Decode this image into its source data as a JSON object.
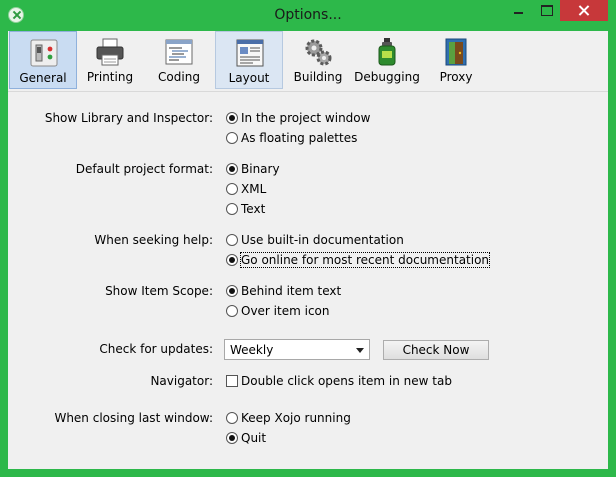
{
  "window": {
    "title": "Options..."
  },
  "toolbar": {
    "items": [
      {
        "label": "General",
        "icon": "general-settings-icon",
        "selected": true
      },
      {
        "label": "Printing",
        "icon": "printer-icon",
        "selected": false
      },
      {
        "label": "Coding",
        "icon": "code-editor-icon",
        "selected": false
      },
      {
        "label": "Layout",
        "icon": "layout-icon",
        "selected": false
      },
      {
        "label": "Building",
        "icon": "gears-icon",
        "selected": false
      },
      {
        "label": "Debugging",
        "icon": "bug-spray-icon",
        "selected": false
      },
      {
        "label": "Proxy",
        "icon": "proxy-door-icon",
        "selected": false
      }
    ]
  },
  "settings": {
    "library_inspector": {
      "label": "Show Library and Inspector:",
      "options": [
        {
          "label": "In the project window",
          "selected": true
        },
        {
          "label": "As floating palettes",
          "selected": false
        }
      ]
    },
    "project_format": {
      "label": "Default project format:",
      "options": [
        {
          "label": "Binary",
          "selected": true
        },
        {
          "label": "XML",
          "selected": false
        },
        {
          "label": "Text",
          "selected": false
        }
      ]
    },
    "seeking_help": {
      "label": "When seeking help:",
      "options": [
        {
          "label": "Use built-in documentation",
          "selected": false
        },
        {
          "label": "Go online for most recent documentation",
          "selected": true
        }
      ]
    },
    "item_scope": {
      "label": "Show Item Scope:",
      "options": [
        {
          "label": "Behind item text",
          "selected": true
        },
        {
          "label": "Over item icon",
          "selected": false
        }
      ]
    },
    "updates": {
      "label": "Check for updates:",
      "value": "Weekly",
      "button_label": "Check Now"
    },
    "navigator": {
      "label": "Navigator:",
      "checkbox_label": "Double click opens item in new tab",
      "checked": false
    },
    "closing": {
      "label": "When closing last window:",
      "options": [
        {
          "label": "Keep Xojo running",
          "selected": false
        },
        {
          "label": "Quit",
          "selected": true
        }
      ]
    }
  }
}
